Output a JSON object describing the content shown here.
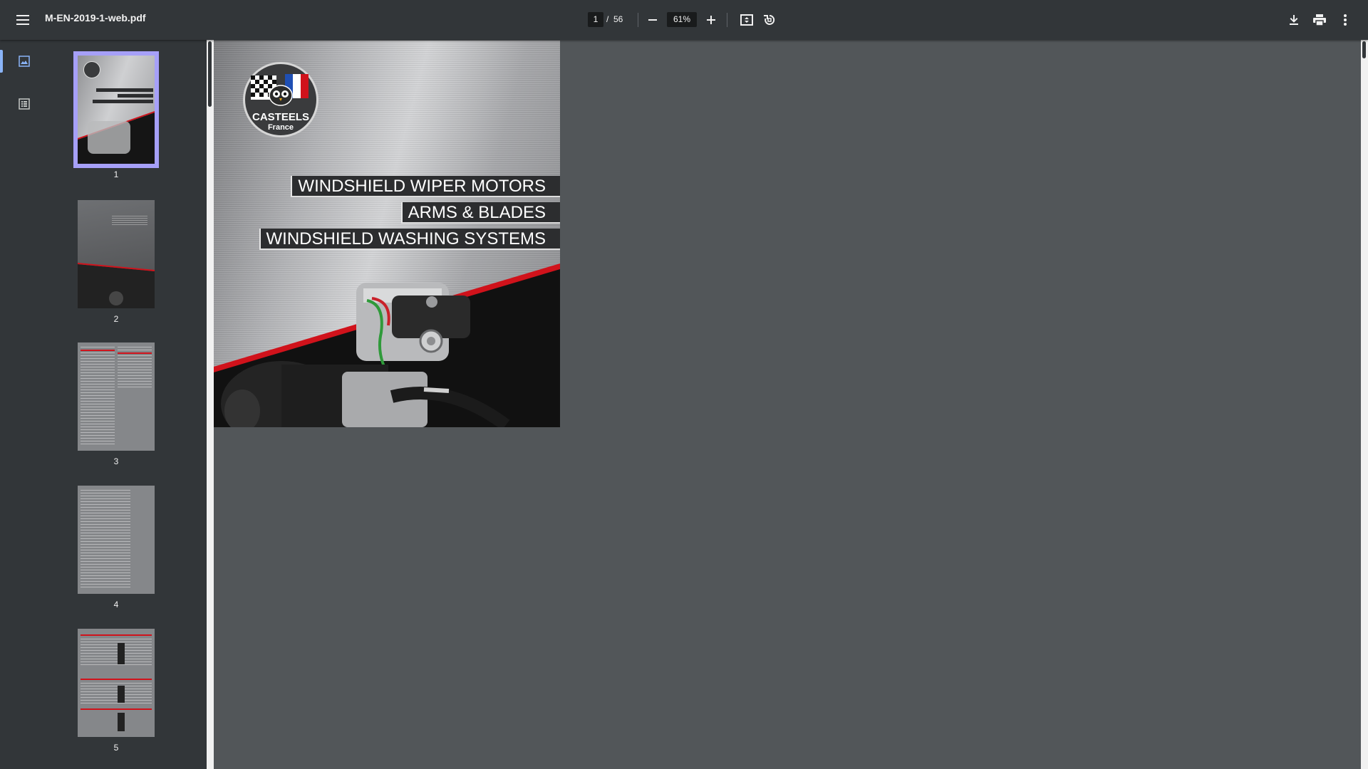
{
  "toolbar": {
    "title": "M-EN-2019-1-web.pdf",
    "page_current": "1",
    "page_separator": "/",
    "page_total": "56",
    "zoom": "61%"
  },
  "sidebar": {
    "thumbnails": [
      {
        "label": "1",
        "selected": true
      },
      {
        "label": "2"
      },
      {
        "label": "3"
      },
      {
        "label": "4"
      },
      {
        "label": "5"
      }
    ]
  },
  "page": {
    "logo_name": "CASTEELS",
    "logo_sub": "France",
    "headings": [
      "WINDSHIELD WIPER MOTORS",
      "ARMS & BLADES",
      "WINDSHIELD WASHING SYSTEMS"
    ]
  },
  "colors": {
    "toolbar_bg": "#323639",
    "viewer_bg": "#525659",
    "selection": "#a6a0f8",
    "accent_red": "#d0121b"
  }
}
